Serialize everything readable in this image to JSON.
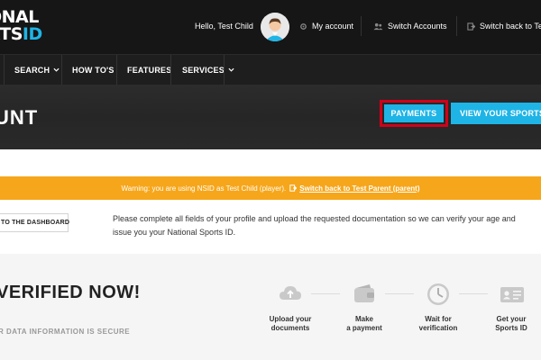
{
  "header": {
    "logo": {
      "line1": "ONAL",
      "line2_main": "RTS",
      "line2_accent": "ID"
    },
    "greeting": "Hello, Test Child",
    "nav": [
      {
        "label": "My account",
        "icon": "gear-icon"
      },
      {
        "label": "Switch Accounts",
        "icon": "users-icon"
      },
      {
        "label": "Switch back to Test",
        "icon": "switch-icon"
      }
    ]
  },
  "main_nav": {
    "items": [
      {
        "label": "SEARCH",
        "has_dropdown": true
      },
      {
        "label": "HOW TO'S",
        "has_dropdown": false
      },
      {
        "label": "FEATURES",
        "has_dropdown": false
      },
      {
        "label": "SERVICES",
        "has_dropdown": true
      }
    ]
  },
  "hero": {
    "title": "UNT",
    "payments_label": "PAYMENTS",
    "view_id_label": "VIEW YOUR SPORTS ID"
  },
  "warning": {
    "text": "Warning: you are using NSID as Test Child (player).",
    "link": "Switch back to Test Parent (parent)"
  },
  "dashboard": {
    "button_label": "TO THE DASHBOARD",
    "info": "Please complete all fields of your profile and upload the requested documentation so we can verify your age and issue you your National Sports ID."
  },
  "verification": {
    "title": "VERIFIED NOW!",
    "subtitle": "R DATA INFORMATION IS SECURE",
    "steps": [
      {
        "line1": "Upload your",
        "line2": "documents",
        "icon": "cloud-upload-icon"
      },
      {
        "line1": "Make",
        "line2": "a payment",
        "icon": "wallet-icon"
      },
      {
        "line1": "Wait for",
        "line2": "verification",
        "icon": "clock-icon"
      },
      {
        "line1": "Get your",
        "line2": "Sports ID",
        "icon": "id-card-icon"
      }
    ]
  },
  "colors": {
    "accent": "#1fb4e6",
    "warning": "#f6a61b",
    "highlight": "#d0021b",
    "dark": "#161616"
  }
}
